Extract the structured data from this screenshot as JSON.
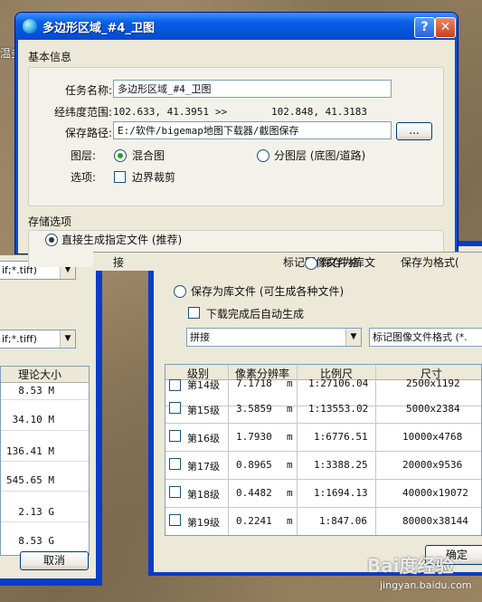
{
  "map": {
    "label_left": "温多"
  },
  "main_dialog": {
    "title": "多边形区域_#4_卫图",
    "help": "?",
    "close": "✕",
    "basic_group": "基本信息",
    "task_name_label": "任务名称:",
    "task_name_value": "多边形区域_#4_卫图",
    "range_label": "经纬度范围:",
    "range_from": "102.633, 41.3951",
    "range_arrow": ">>",
    "range_to": "102.848, 41.3183",
    "save_path_label": "保存路径:",
    "save_path_value": "E:/软件/bigemap地图下载器/截图保存",
    "browse": "...",
    "layer_label": "图层:",
    "layer_mixed": "混合图",
    "layer_split": "分图层 (底图/道路)",
    "options_label": "选项:",
    "boundary_crop": "边界裁剪",
    "storage_group": "存储选项",
    "direct_generate": "直接生成指定文件 (推荐)",
    "overlap_text_1": "接",
    "overlap_text_2": "标记图像文件格",
    "overlap_text_3": "保存为库文",
    "overlap_text_4": "保存为格式("
  },
  "left_dialog": {
    "combo1": "if;*.tiff)",
    "combo2": "if;*.tiff)",
    "size_header": "理论大小",
    "sizes": [
      "8.53 M",
      "34.10 M",
      "136.41 M",
      "545.65 M",
      "2.13 G",
      "8.53 G"
    ],
    "cancel": "取消"
  },
  "right_dialog": {
    "save_library": "保存为库文件 (可生成各种文件)",
    "auto_generate": "下载完成后自动生成",
    "mosaic": "拼接",
    "mark_format": "标记图像文件格式 (*.",
    "headers": {
      "level": "级别",
      "res": "像素分辨率",
      "scale": "比例尺",
      "size": "尺寸"
    },
    "rows": [
      {
        "level": "第14级",
        "res": "7.1718",
        "unit": "m",
        "scale": "1:27106.04",
        "size": "2500x1192"
      },
      {
        "level": "第15级",
        "res": "3.5859",
        "unit": "m",
        "scale": "1:13553.02",
        "size": "5000x2384"
      },
      {
        "level": "第16级",
        "res": "1.7930",
        "unit": "m",
        "scale": "1:6776.51",
        "size": "10000x4768"
      },
      {
        "level": "第17级",
        "res": "0.8965",
        "unit": "m",
        "scale": "1:3388.25",
        "size": "20000x9536"
      },
      {
        "level": "第18级",
        "res": "0.4482",
        "unit": "m",
        "scale": "1:1694.13",
        "size": "40000x19072"
      },
      {
        "level": "第19级",
        "res": "0.2241",
        "unit": "m",
        "scale": "1:847.06",
        "size": "80000x38144"
      }
    ],
    "ok": "确定"
  },
  "watermark": {
    "brand": "Bai度经验",
    "url": "jingyan.baidu.com"
  }
}
